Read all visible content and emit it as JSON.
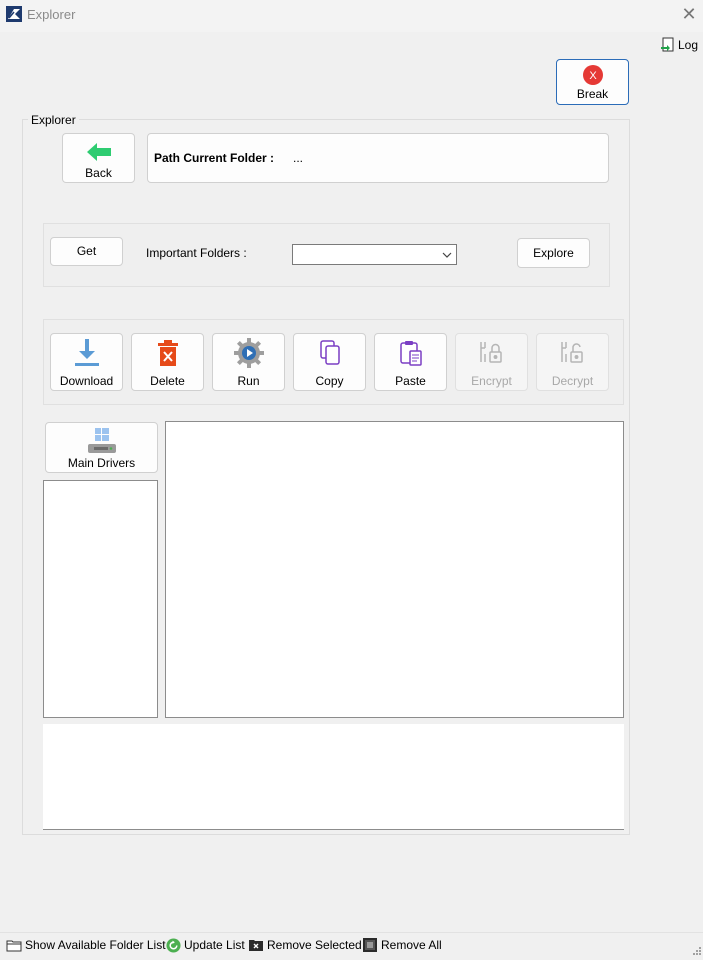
{
  "window": {
    "title": "Explorer"
  },
  "log": {
    "label": "Log"
  },
  "break_button": {
    "label": "Break",
    "icon": "stop-x-icon",
    "icon_color": "#e53935"
  },
  "group": {
    "legend": "Explorer"
  },
  "back_button": {
    "label": "Back",
    "icon": "arrow-left-icon",
    "icon_color": "#2ecc71"
  },
  "path": {
    "label": "Path Current Folder :",
    "value": "..."
  },
  "folders_row": {
    "get_label": "Get",
    "important_label": "Important Folders :",
    "select_value": "",
    "explore_label": "Explore"
  },
  "actions": [
    {
      "label": "Download",
      "icon": "download-icon",
      "enabled": true
    },
    {
      "label": "Delete",
      "icon": "trash-icon",
      "enabled": true
    },
    {
      "label": "Run",
      "icon": "gear-play-icon",
      "enabled": true
    },
    {
      "label": "Copy",
      "icon": "copy-icon",
      "enabled": true
    },
    {
      "label": "Paste",
      "icon": "paste-icon",
      "enabled": true
    },
    {
      "label": "Encrypt",
      "icon": "lock-icon",
      "enabled": false
    },
    {
      "label": "Decrypt",
      "icon": "unlock-icon",
      "enabled": false
    }
  ],
  "drivers": {
    "label": "Main Drivers",
    "icon": "drive-icon"
  },
  "statusbar": {
    "show_available": "Show Available Folder List",
    "update_list": "Update List",
    "remove_selected": "Remove Selected",
    "remove_all": "Remove All"
  },
  "colors": {
    "accent_border": "#2b6cb8",
    "background": "#f0f0f0"
  }
}
